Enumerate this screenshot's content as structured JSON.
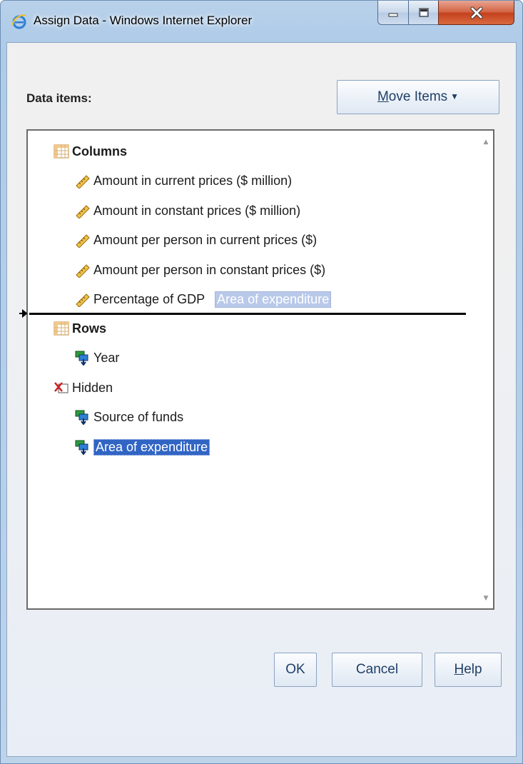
{
  "window": {
    "title": "Assign Data - Windows Internet Explorer"
  },
  "dialog": {
    "data_items_label": "Data items:",
    "move_items": {
      "prefix": "",
      "accel": "M",
      "rest": "ove Items"
    },
    "tree": {
      "columns": {
        "label": "Columns",
        "items": [
          "Amount in current prices ($ million)",
          "Amount in constant prices ($ million)",
          "Amount per person in current prices ($)",
          "Amount per person in constant prices ($)",
          "Percentage of GDP"
        ]
      },
      "drag_ghost": "Area of expenditure",
      "rows": {
        "label": "Rows",
        "items": [
          "Year"
        ]
      },
      "hidden": {
        "label": "Hidden",
        "items": [
          "Source of funds",
          "Area of expenditure"
        ]
      },
      "selected_item": "Area of expenditure"
    },
    "buttons": {
      "ok": "OK",
      "cancel": "Cancel",
      "help": {
        "accel": "H",
        "rest": "elp"
      }
    }
  },
  "colors": {
    "selection": "#3165c4",
    "drag_ghost_bg": "#b9c9ea",
    "close_button": "#c4401d",
    "title_bar": "#b9d1ea"
  },
  "icons": {
    "columns": "table-grid-icon",
    "measure": "ruler-icon",
    "category": "category-hierarchy-icon",
    "hidden": "hidden-folder-icon"
  }
}
